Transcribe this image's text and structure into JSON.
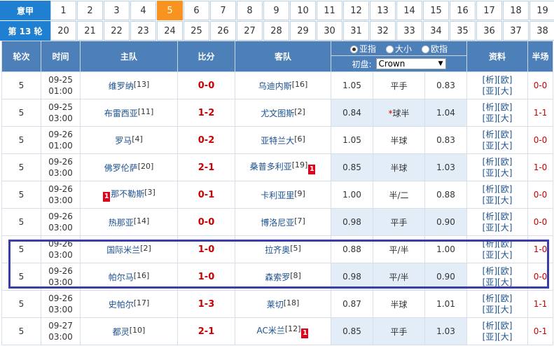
{
  "rounds": {
    "label_top": "意甲",
    "label_bottom": "第 13 轮",
    "row1": [
      "1",
      "2",
      "3",
      "4",
      "5",
      "6",
      "7",
      "8",
      "9",
      "10",
      "11",
      "12",
      "13",
      "14",
      "15",
      "16",
      "17",
      "18",
      "19"
    ],
    "row2": [
      "20",
      "21",
      "22",
      "23",
      "24",
      "25",
      "26",
      "27",
      "28",
      "29",
      "30",
      "31",
      "32",
      "33",
      "34",
      "35",
      "36",
      "37",
      "38"
    ],
    "active": "5"
  },
  "header": {
    "round": "轮次",
    "time": "时间",
    "home": "主队",
    "score": "比分",
    "away": "客队",
    "odds_options": [
      "亚指",
      "大小",
      "欧指"
    ],
    "odds_selected": "亚指",
    "initial_label": "初盘:",
    "bookmaker": "Crown",
    "info": "资料",
    "half": "半场"
  },
  "info_links": [
    "[析]",
    "[欧]",
    "[亚]",
    "[大]"
  ],
  "matches": [
    {
      "round": "5",
      "date": "09-25",
      "time": "01:00",
      "home": "维罗纳",
      "home_rank": "[13]",
      "home_red": "",
      "score": "0-0",
      "away": "乌迪内斯",
      "away_rank": "[16]",
      "away_red": "",
      "o1": "1.05",
      "line": "平手",
      "line_star": "",
      "o3": "0.83",
      "half": "0-0"
    },
    {
      "round": "5",
      "date": "09-25",
      "time": "03:00",
      "home": "布雷西亚",
      "home_rank": "[11]",
      "home_red": "",
      "score": "1-2",
      "away": "尤文图斯",
      "away_rank": "[2]",
      "away_red": "",
      "o1": "0.84",
      "line": "球半",
      "line_star": "*",
      "o3": "1.04",
      "half": "1-1"
    },
    {
      "round": "5",
      "date": "09-26",
      "time": "01:00",
      "home": "罗马",
      "home_rank": "[4]",
      "home_red": "",
      "score": "0-2",
      "away": "亚特兰大",
      "away_rank": "[6]",
      "away_red": "",
      "o1": "1.05",
      "line": "半球",
      "line_star": "",
      "o3": "0.83",
      "half": "0-0"
    },
    {
      "round": "5",
      "date": "09-26",
      "time": "03:00",
      "home": "佛罗伦萨",
      "home_rank": "[20]",
      "home_red": "",
      "score": "2-1",
      "away": "桑普多利亚",
      "away_rank": "[19]",
      "away_red": "1",
      "o1": "0.85",
      "line": "半球",
      "line_star": "",
      "o3": "1.03",
      "half": "1-0"
    },
    {
      "round": "5",
      "date": "09-26",
      "time": "03:00",
      "home": "那不勒斯",
      "home_rank": "[3]",
      "home_red": "1",
      "score": "0-1",
      "away": "卡利亚里",
      "away_rank": "[9]",
      "away_red": "",
      "o1": "1.00",
      "line": "半/二",
      "line_star": "",
      "o3": "0.88",
      "half": "0-0"
    },
    {
      "round": "5",
      "date": "09-26",
      "time": "03:00",
      "home": "热那亚",
      "home_rank": "[14]",
      "home_red": "",
      "score": "0-0",
      "away": "博洛尼亚",
      "away_rank": "[7]",
      "away_red": "",
      "o1": "0.98",
      "line": "平手",
      "line_star": "",
      "o3": "0.90",
      "half": "0-0"
    },
    {
      "round": "5",
      "date": "09-26",
      "time": "03:00",
      "home": "国际米兰",
      "home_rank": "[2]",
      "home_red": "",
      "score": "1-0",
      "away": "拉齐奥",
      "away_rank": "[5]",
      "away_red": "",
      "o1": "0.88",
      "line": "平/半",
      "line_star": "",
      "o3": "1.00",
      "half": "1-0"
    },
    {
      "round": "5",
      "date": "09-26",
      "time": "03:00",
      "home": "帕尔马",
      "home_rank": "[16]",
      "home_red": "",
      "score": "1-0",
      "away": "森索罗",
      "away_rank": "[8]",
      "away_red": "",
      "o1": "0.98",
      "line": "平/半",
      "line_star": "",
      "o3": "0.90",
      "half": "0-0"
    },
    {
      "round": "5",
      "date": "09-26",
      "time": "03:00",
      "home": "史帕尔",
      "home_rank": "[17]",
      "home_red": "",
      "score": "1-3",
      "away": "莱切",
      "away_rank": "[18]",
      "away_red": "",
      "o1": "0.87",
      "line": "半球",
      "line_star": "",
      "o3": "1.01",
      "half": "1-1"
    },
    {
      "round": "5",
      "date": "09-27",
      "time": "03:00",
      "home": "都灵",
      "home_rank": "[10]",
      "home_red": "",
      "score": "2-1",
      "away": "AC米兰",
      "away_rank": "[12]",
      "away_red": "1",
      "o1": "0.85",
      "line": "平手",
      "line_star": "",
      "o3": "1.03",
      "half": "0-1"
    }
  ],
  "colors": {
    "header_bg": "#4d7fb8",
    "accent": "#f7931e",
    "score": "#cc0000",
    "highlight_box": "#3b3ea8"
  }
}
